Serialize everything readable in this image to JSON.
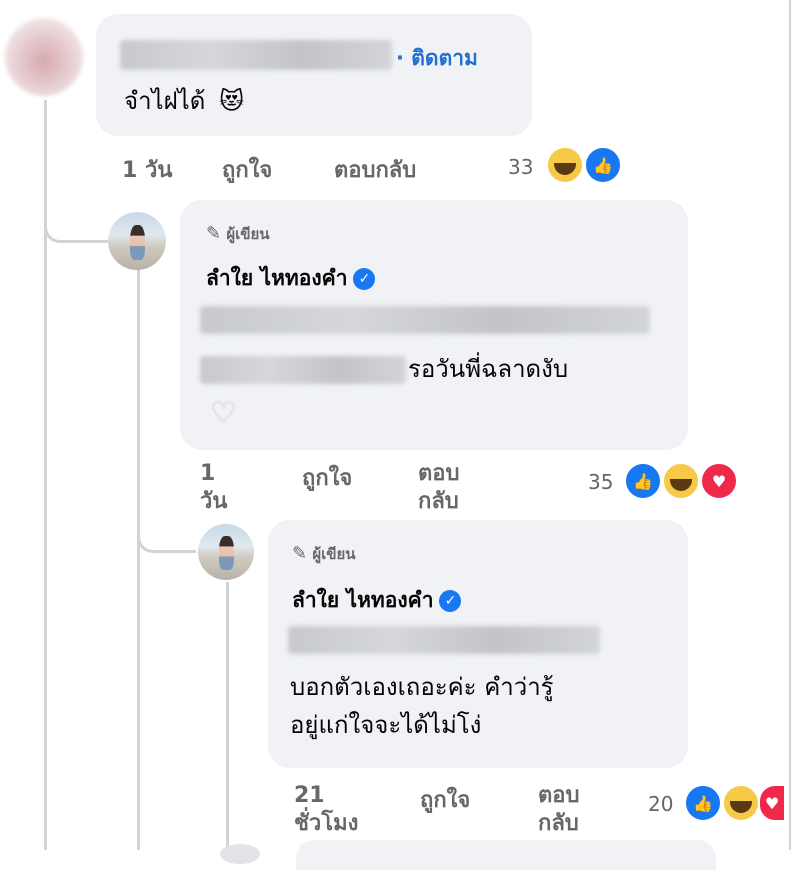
{
  "comments": [
    {
      "name_label": "",
      "follow": "· ติดตาม",
      "text": "จำไฝได้",
      "emoji": "😻",
      "time": "1 วัน",
      "like": "ถูกใจ",
      "reply": "ตอบกลับ",
      "count": "33",
      "reactions": [
        "haha",
        "like"
      ]
    },
    {
      "author_tag": "ผู้เขียน",
      "name": "ลำใย ไหทองคำ",
      "text": "รอวันพี่ฉลาดงับ",
      "time_l1": "1",
      "time_l2": "วัน",
      "like": "ถูกใจ",
      "reply_l1": "ตอบ",
      "reply_l2": "กลับ",
      "count": "35",
      "reactions": [
        "like",
        "haha",
        "love"
      ]
    },
    {
      "author_tag": "ผู้เขียน",
      "name": "ลำใย ไหทองคำ",
      "text_l1": "บอกตัวเองเถอะค่ะ คำว่ารู้",
      "text_l2": "อยู่แก่ใจจะได้ไม่โง่",
      "time_l1": "21",
      "time_l2": "ชั่วโมง",
      "like": "ถูกใจ",
      "reply_l1": "ตอบ",
      "reply_l2": "กลับ",
      "count": "20",
      "reactions": [
        "like",
        "haha",
        "love"
      ]
    }
  ],
  "colors": {
    "link_blue": "#1f6fd1",
    "bubble": "#f0f2f5",
    "meta_grey": "#65676b",
    "like_blue": "#1877f2",
    "love_red": "#f02849",
    "haha_yellow": "#f7c948"
  },
  "icons": {
    "author": "pencil-icon",
    "verified": "verified-badge-icon",
    "heart": "heart-outline-icon"
  }
}
